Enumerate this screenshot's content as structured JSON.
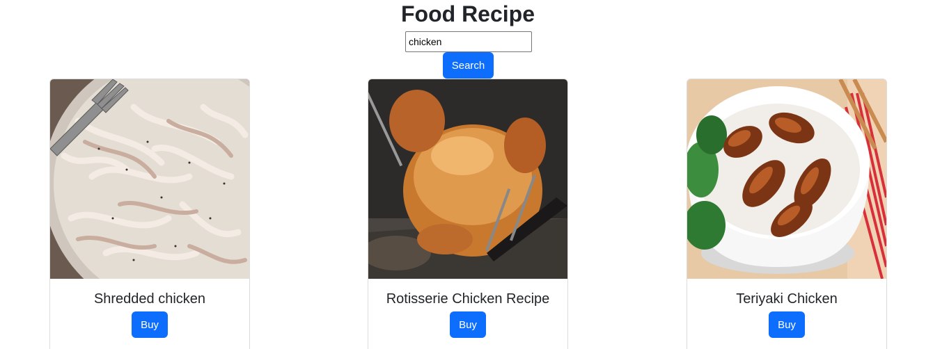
{
  "header": {
    "title": "Food Recipe"
  },
  "search": {
    "value": "chicken",
    "button_label": "Search"
  },
  "recipes": [
    {
      "title": "Shredded chicken",
      "button_label": "Buy"
    },
    {
      "title": "Rotisserie Chicken Recipe",
      "button_label": "Buy"
    },
    {
      "title": "Teriyaki Chicken",
      "button_label": "Buy"
    }
  ],
  "colors": {
    "primary": "#0d6efd",
    "text": "#212529",
    "card_border": "#dcdcdc"
  }
}
